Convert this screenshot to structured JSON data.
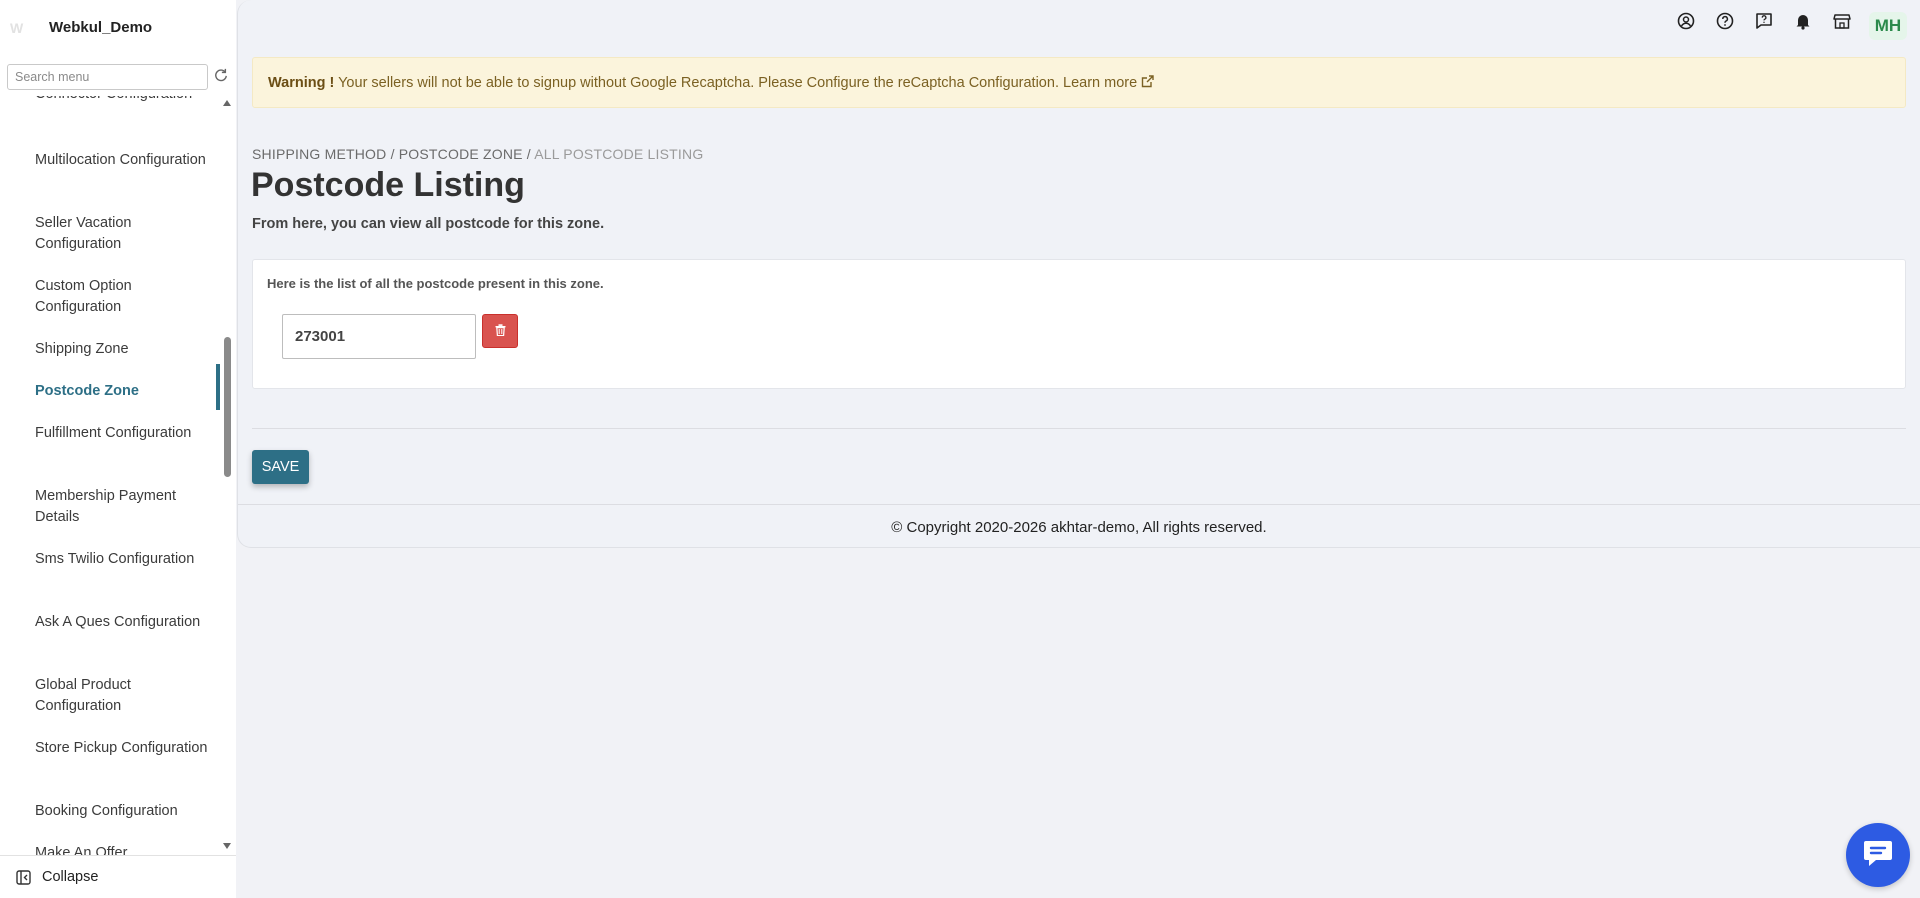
{
  "brand": {
    "name": "Webkul_Demo",
    "logo_text": "W"
  },
  "sidebar": {
    "search_placeholder": "Search menu",
    "items": [
      {
        "label": "Connector Configuration"
      },
      {
        "label": "Multilocation Configuration"
      },
      {
        "label": "Seller Vacation Configuration"
      },
      {
        "label": "Custom Option Configuration"
      },
      {
        "label": "Shipping Zone"
      },
      {
        "label": "Postcode Zone",
        "active": true
      },
      {
        "label": "Fulfillment Configuration"
      },
      {
        "label": "Membership Payment Details"
      },
      {
        "label": "Sms Twilio Configuration"
      },
      {
        "label": "Ask A Ques Configuration"
      },
      {
        "label": "Global Product Configuration"
      },
      {
        "label": "Store Pickup Configuration"
      },
      {
        "label": "Booking Configuration"
      },
      {
        "label": "Make An Offer"
      }
    ],
    "collapse_label": "Collapse"
  },
  "topbar": {
    "icons": [
      "account-circle-icon",
      "help-icon",
      "feedback-icon",
      "bell-icon",
      "store-icon"
    ],
    "avatar_initials": "MH"
  },
  "warning": {
    "label": "Warning !",
    "message": "Your sellers will not be able to signup without Google Recaptcha. Please Configure the reCaptcha Configuration.",
    "link": "Learn more"
  },
  "breadcrumb": {
    "items": [
      "SHIPPING METHOD",
      "POSTCODE ZONE"
    ],
    "current": "ALL POSTCODE LISTING"
  },
  "page": {
    "title": "Postcode Listing",
    "subtitle": "From here, you can view all postcode for this zone."
  },
  "postcodes": {
    "note": "Here is the list of all the postcode present in this zone.",
    "values": [
      "273001"
    ]
  },
  "actions": {
    "save_label": "SAVE"
  },
  "footer": {
    "copyright": "© Copyright 2020-2026 akhtar-demo, All rights reserved."
  },
  "colors": {
    "accent": "#2d6f86",
    "danger": "#d9534f",
    "warning_bg": "#fbf4dc",
    "chat": "#2d5be3"
  }
}
